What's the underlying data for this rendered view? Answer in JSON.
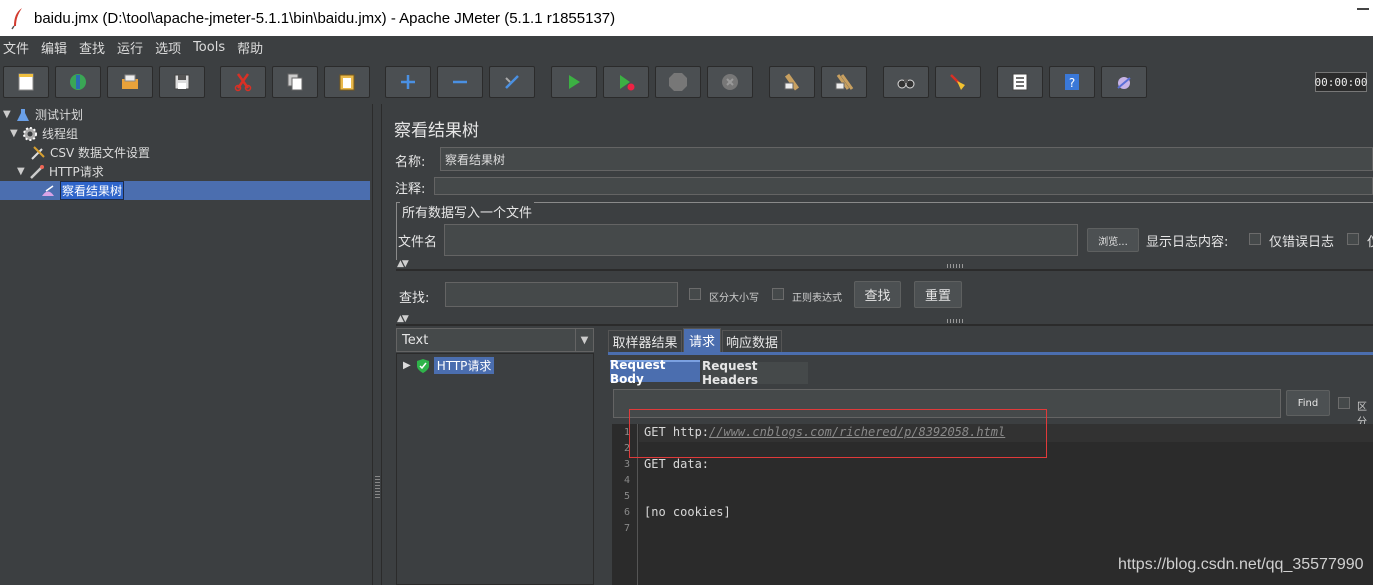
{
  "window": {
    "title": "baidu.jmx (D:\\tool\\apache-jmeter-5.1.1\\bin\\baidu.jmx) - Apache JMeter (5.1.1 r1855137)"
  },
  "menu": [
    "文件",
    "编辑",
    "查找",
    "运行",
    "选项",
    "Tools",
    "帮助"
  ],
  "toolbar": {
    "icons": [
      "new-icon",
      "templates-icon",
      "open-icon",
      "save-icon",
      "cut-icon",
      "copy-icon",
      "paste-icon",
      "expand-icon",
      "collapse-icon",
      "toggle-icon",
      "start-icon",
      "start-no-pause-icon",
      "stop-icon",
      "shutdown-icon",
      "clear-icon",
      "clear-all-icon",
      "search-icon",
      "reset-search-icon",
      "function-helper-icon",
      "help-icon",
      "remote-icon"
    ],
    "timer": "00:00:00"
  },
  "tree": {
    "items": [
      {
        "label": "测试计划"
      },
      {
        "label": "线程组"
      },
      {
        "label": "CSV 数据文件设置"
      },
      {
        "label": "HTTP请求"
      },
      {
        "label": "察看结果树"
      }
    ]
  },
  "panel": {
    "title": "察看结果树",
    "name_label": "名称:",
    "name_value": "察看结果树",
    "comment_label": "注释:",
    "comment_value": "",
    "file_group_title": "所有数据写入一个文件",
    "filename_label": "文件名",
    "filename_value": "",
    "browse_label": "浏览...",
    "log_display_label": "显示日志内容:",
    "errors_only_label": "仅错误日志",
    "success_only_label": "仅",
    "search_label": "查找:",
    "search_value": "",
    "case_sensitive_label": "区分大小写",
    "regex_label": "正则表达式",
    "find_button": "查找",
    "reset_button": "重置"
  },
  "results": {
    "renderer": "Text",
    "items": [
      {
        "label": "HTTP请求"
      }
    ],
    "tabs": [
      "取样器结果",
      "请求",
      "响应数据"
    ],
    "active_tab": "请求",
    "subtabs": [
      "Request Body",
      "Request Headers"
    ],
    "active_subtab": "Request Body",
    "find_button": "Find",
    "find_cb_label": "区分",
    "lines": [
      "1",
      "2",
      "3",
      "4",
      "5",
      "6",
      "7"
    ],
    "code": {
      "line1_prefix": "GET http:",
      "line1_url": "//www.cnblogs.com/richered/p/8392058.html",
      "line3": "GET data:",
      "line6": "[no cookies]"
    }
  },
  "watermark": "https://blog.csdn.net/qq_35577990"
}
